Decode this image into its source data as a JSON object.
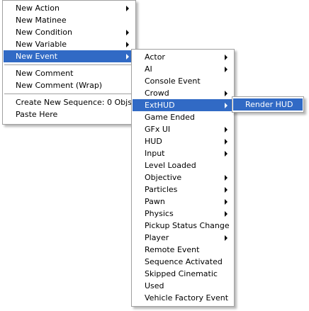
{
  "main_menu": {
    "items": [
      {
        "label": "New Action",
        "submenu": true
      },
      {
        "label": "New Matinee",
        "submenu": false
      },
      {
        "label": "New Condition",
        "submenu": true
      },
      {
        "label": "New Variable",
        "submenu": true
      },
      {
        "label": "New Event",
        "submenu": true,
        "selected": true
      },
      {
        "label": "New Comment",
        "submenu": false
      },
      {
        "label": "New Comment (Wrap)",
        "submenu": false
      },
      {
        "label": "Create New Sequence: 0 Objs",
        "submenu": false
      },
      {
        "label": "Paste Here",
        "submenu": false
      }
    ]
  },
  "event_menu": {
    "items": [
      {
        "label": "Actor",
        "submenu": true
      },
      {
        "label": "AI",
        "submenu": true
      },
      {
        "label": "Console Event",
        "submenu": false
      },
      {
        "label": "Crowd",
        "submenu": true
      },
      {
        "label": "ExtHUD",
        "submenu": true,
        "selected": true
      },
      {
        "label": "Game Ended",
        "submenu": false
      },
      {
        "label": "GFx UI",
        "submenu": true
      },
      {
        "label": "HUD",
        "submenu": true
      },
      {
        "label": "Input",
        "submenu": true
      },
      {
        "label": "Level Loaded",
        "submenu": false
      },
      {
        "label": "Objective",
        "submenu": true
      },
      {
        "label": "Particles",
        "submenu": true
      },
      {
        "label": "Pawn",
        "submenu": true
      },
      {
        "label": "Physics",
        "submenu": true
      },
      {
        "label": "Pickup Status Change",
        "submenu": false
      },
      {
        "label": "Player",
        "submenu": true
      },
      {
        "label": "Remote Event",
        "submenu": false
      },
      {
        "label": "Sequence Activated",
        "submenu": false
      },
      {
        "label": "Skipped Cinematic",
        "submenu": false
      },
      {
        "label": "Used",
        "submenu": false
      },
      {
        "label": "Vehicle Factory Event",
        "submenu": false
      }
    ]
  },
  "exthud_menu": {
    "items": [
      {
        "label": "Render HUD",
        "submenu": false
      }
    ]
  },
  "colors": {
    "highlight": "#316ac5",
    "menu_background": "#ffffff",
    "separator": "#a0a0a0"
  }
}
